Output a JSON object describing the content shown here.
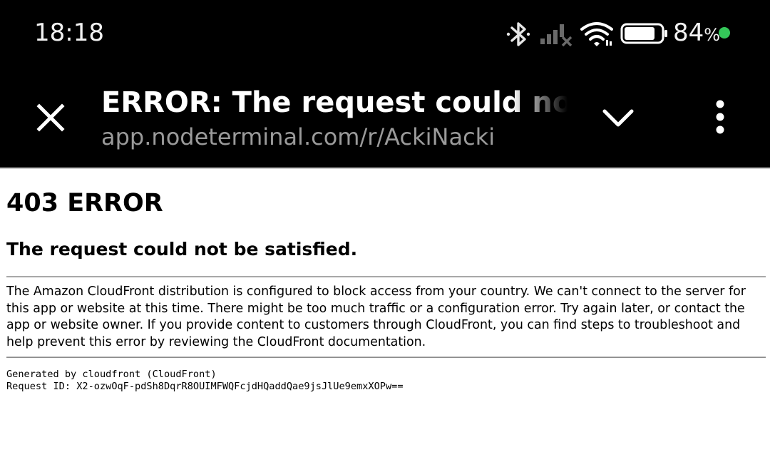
{
  "status_bar": {
    "time": "18:18",
    "battery_percent": "84",
    "battery_unit": "%",
    "battery_level": 0.84,
    "icons": [
      "bluetooth-icon",
      "cell-signal-icon",
      "wifi-icon",
      "battery-icon"
    ],
    "dot_color": "#34c759"
  },
  "toolbar": {
    "title": "ERROR: The request could not be satisfied",
    "url": "app.nodeterminal.com/r/AckiNacki",
    "icons": [
      "close-icon",
      "chevron-down-icon",
      "more-vert-icon"
    ]
  },
  "page": {
    "heading": "403 ERROR",
    "subheading": "The request could not be satisfied.",
    "description": "The Amazon CloudFront distribution is configured to block access from your country. We can't connect to the server for this app or website at this time. There might be too much traffic or a configuration error. Try again later, or contact the app or website owner. If you provide content to customers through CloudFront, you can find steps to troubleshoot and help prevent this error by reviewing the CloudFront documentation.",
    "generated_by": "Generated by cloudfront (CloudFront)",
    "request_id": "Request ID: X2-ozwOqF-pdSh8DqrR8OUIMFWQFcjdHQaddQae9jsJlUe9emxXOPw=="
  }
}
